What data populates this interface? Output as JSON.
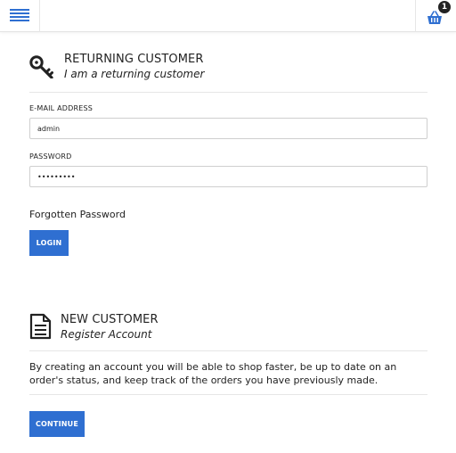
{
  "header": {
    "menu_icon": "hamburger-menu-icon",
    "cart_icon": "shopping-basket-icon",
    "cart_count": "1",
    "accent": "#2f6fd1"
  },
  "returning": {
    "icon": "key-icon",
    "title": "RETURNING CUSTOMER",
    "subtitle": "I am a returning customer",
    "email_label": "E-MAIL ADDRESS",
    "email_value": "admin",
    "password_label": "PASSWORD",
    "password_value": "•••••••••",
    "forgot_label": "Forgotten Password",
    "login_label": "LOGIN"
  },
  "new_customer": {
    "icon": "document-icon",
    "title": "NEW CUSTOMER",
    "subtitle": "Register Account",
    "description": "By creating an account you will be able to shop faster, be up to date on an order's status, and keep track of the orders you have previously made.",
    "continue_label": "CONTINUE"
  }
}
